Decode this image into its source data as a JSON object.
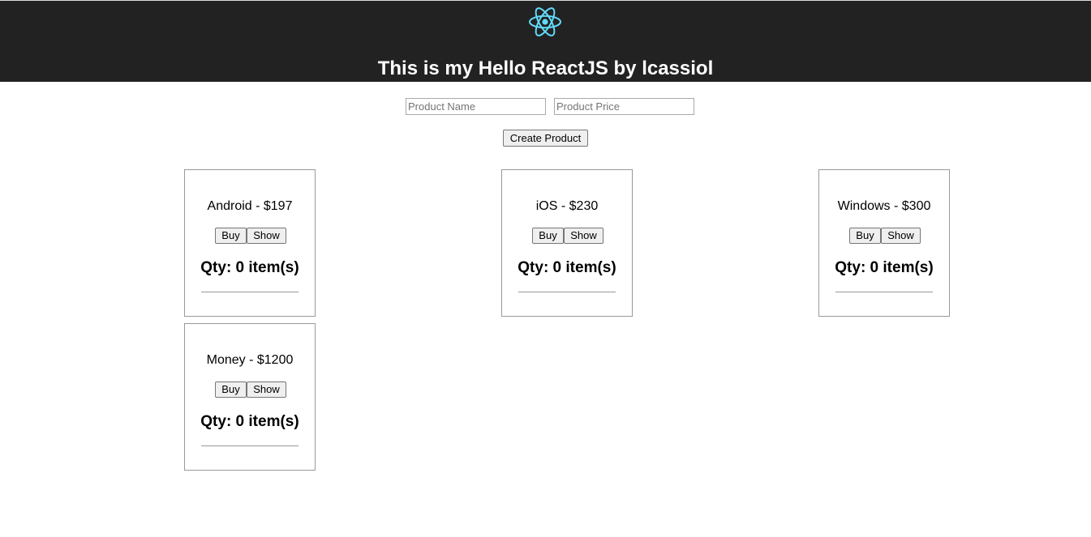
{
  "header": {
    "title": "This is my Hello ReactJS by lcassiol",
    "logo_icon": "react-atom-icon",
    "logo_color": "#61dafb",
    "background": "#222222"
  },
  "form": {
    "name_placeholder": "Product Name",
    "price_placeholder": "Product Price",
    "create_label": "Create Product"
  },
  "products": [
    {
      "label": "Android - $197",
      "buy": "Buy",
      "show": "Show",
      "qty": "Qty: 0 item(s)"
    },
    {
      "label": "iOS - $230",
      "buy": "Buy",
      "show": "Show",
      "qty": "Qty: 0 item(s)"
    },
    {
      "label": "Windows - $300",
      "buy": "Buy",
      "show": "Show",
      "qty": "Qty: 0 item(s)"
    },
    {
      "label": "Money - $1200",
      "buy": "Buy",
      "show": "Show",
      "qty": "Qty: 0 item(s)"
    }
  ]
}
